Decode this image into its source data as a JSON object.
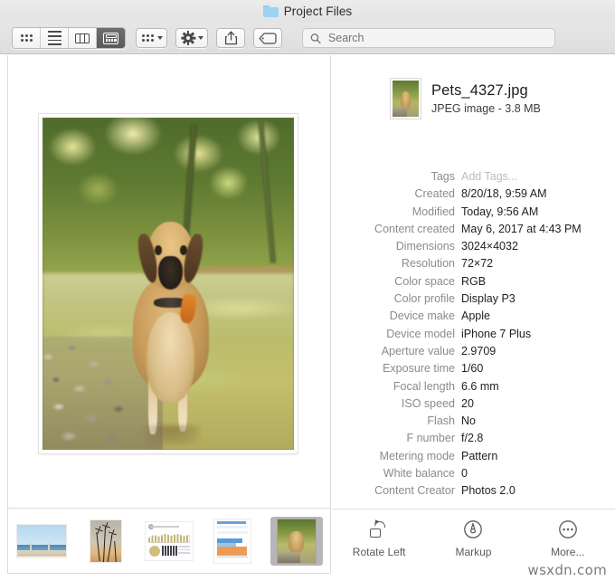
{
  "window": {
    "title": "Project Files",
    "folder_icon": "folder-icon"
  },
  "toolbar": {
    "view_modes": [
      {
        "name": "icon-view",
        "icon": "grid-dots-icon",
        "active": false
      },
      {
        "name": "list-view",
        "icon": "list-lines-icon",
        "active": false
      },
      {
        "name": "column-view",
        "icon": "columns-icon",
        "active": false
      },
      {
        "name": "gallery-view",
        "icon": "gallery-icon",
        "active": true
      }
    ],
    "group_button": {
      "icon": "grid-dots-icon",
      "chevron": "chevron-down-icon"
    },
    "action_button": {
      "icon": "gear-icon",
      "chevron": "chevron-down-icon"
    },
    "share_button": {
      "icon": "share-icon"
    },
    "tag_button": {
      "icon": "tag-icon"
    },
    "search": {
      "icon": "search-icon",
      "placeholder": "Search",
      "value": ""
    }
  },
  "preview": {
    "image_alt": "Dog standing in shallow river with rocks and green foliage"
  },
  "info": {
    "file_name": "Pets_4327.jpg",
    "file_kind": "JPEG image - 3.8 MB",
    "thumbnail": "file-thumbnail",
    "metadata": [
      {
        "label": "Tags",
        "value": "Add Tags...",
        "placeholder": true
      },
      {
        "label": "Created",
        "value": "8/20/18, 9:59 AM",
        "placeholder": false
      },
      {
        "label": "Modified",
        "value": "Today, 9:56 AM",
        "placeholder": false
      },
      {
        "label": "Content created",
        "value": "May 6, 2017 at 4:43 PM",
        "placeholder": false
      },
      {
        "label": "Dimensions",
        "value": "3024×4032",
        "placeholder": false
      },
      {
        "label": "Resolution",
        "value": "72×72",
        "placeholder": false
      },
      {
        "label": "Color space",
        "value": "RGB",
        "placeholder": false
      },
      {
        "label": "Color profile",
        "value": "Display P3",
        "placeholder": false
      },
      {
        "label": "Device make",
        "value": "Apple",
        "placeholder": false
      },
      {
        "label": "Device model",
        "value": "iPhone 7 Plus",
        "placeholder": false
      },
      {
        "label": "Aperture value",
        "value": "2.9709",
        "placeholder": false
      },
      {
        "label": "Exposure time",
        "value": "1/60",
        "placeholder": false
      },
      {
        "label": "Focal length",
        "value": "6.6 mm",
        "placeholder": false
      },
      {
        "label": "ISO speed",
        "value": "20",
        "placeholder": false
      },
      {
        "label": "Flash",
        "value": "No",
        "placeholder": false
      },
      {
        "label": "F number",
        "value": "f/2.8",
        "placeholder": false
      },
      {
        "label": "Metering mode",
        "value": "Pattern",
        "placeholder": false
      },
      {
        "label": "White balance",
        "value": "0",
        "placeholder": false
      },
      {
        "label": "Content Creator",
        "value": "Photos 2.0",
        "placeholder": false
      }
    ]
  },
  "thumbnails": [
    {
      "name": "thumbnail-beach",
      "kind": "beach",
      "selected": false
    },
    {
      "name": "thumbnail-plants",
      "kind": "plants",
      "selected": false
    },
    {
      "name": "thumbnail-document",
      "kind": "document",
      "selected": false
    },
    {
      "name": "thumbnail-spreadsheet",
      "kind": "spreadsheet",
      "selected": false
    },
    {
      "name": "thumbnail-dog",
      "kind": "photo",
      "selected": true
    }
  ],
  "actions": [
    {
      "label": "Rotate Left",
      "icon": "rotate-left-icon"
    },
    {
      "label": "Markup",
      "icon": "markup-icon"
    },
    {
      "label": "More...",
      "icon": "more-icon"
    }
  ],
  "watermark": "wsxdn.com",
  "colors": {
    "toolbar_bg": "#e3e3e3",
    "titlebar_bg": "#ececec",
    "selected_segment": "#5f5f5f",
    "folder_blue": "#9ad4f2",
    "label_gray": "#8b8b8b",
    "value_dark": "#1f1f1f",
    "placeholder_gray": "#bdbdbd",
    "thumb_selected_bg": "#b6b6b6"
  }
}
